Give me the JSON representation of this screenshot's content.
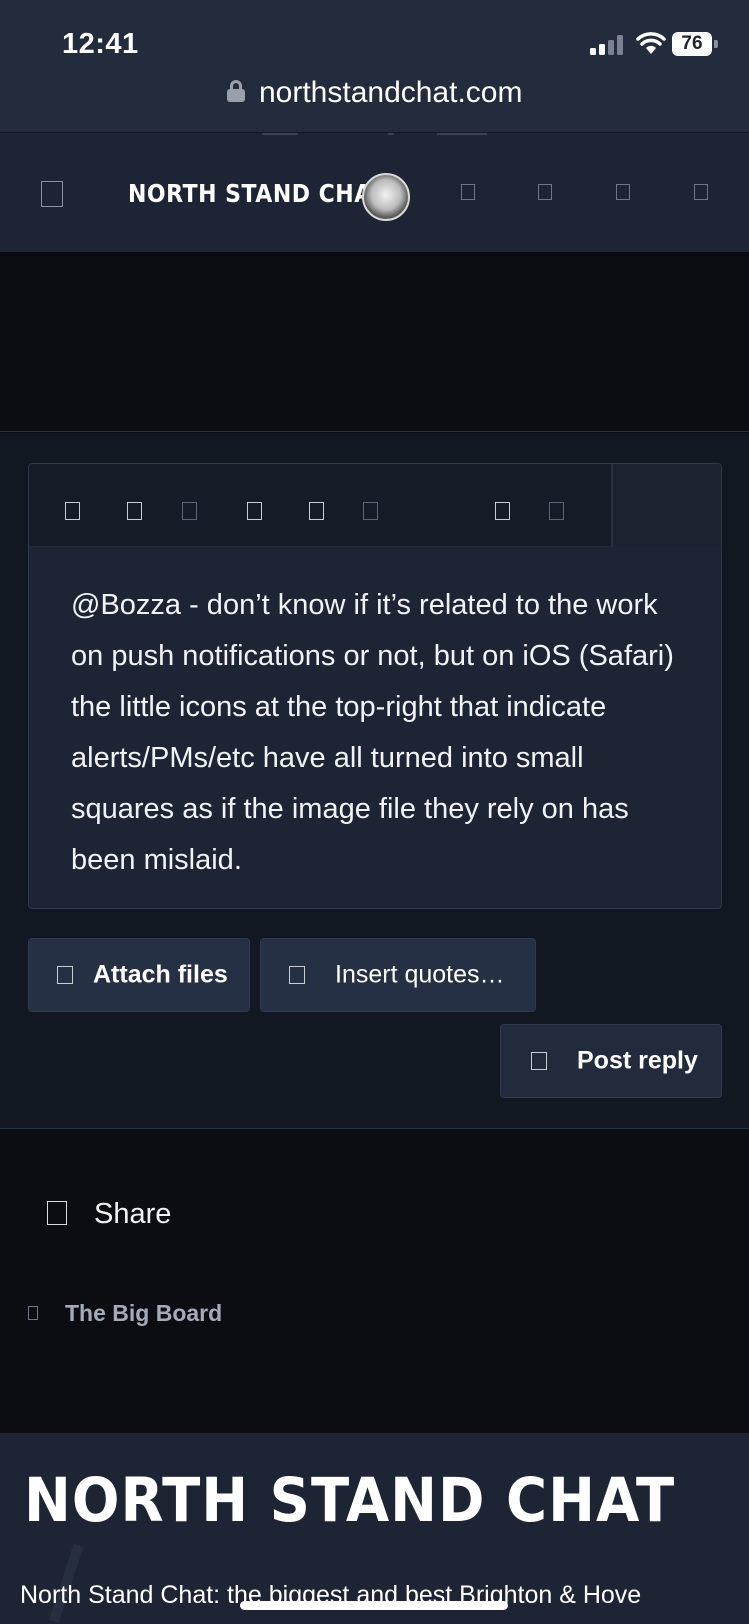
{
  "status_bar": {
    "time": "12:41",
    "battery": "76"
  },
  "browser": {
    "url": "northstandchat.com"
  },
  "site_header": {
    "logo_text": "NORTH STAND CHAT"
  },
  "editor": {
    "text": "@Bozza - don’t know if it’s related to the work on push notifications or not, but on iOS (Safari) the little icons at the top-right that indicate alerts/PMs/etc have all turned into small squares as if the image file they rely on has been mislaid."
  },
  "actions": {
    "attach_label": "Attach files",
    "quotes_label": "Insert quotes…",
    "post_label": "Post reply"
  },
  "share": {
    "label": "Share"
  },
  "breadcrumb": {
    "label": "The Big Board"
  },
  "footer": {
    "logo_text": "NORTH STAND CHAT",
    "description": "North Stand Chat: the biggest and best Brighton & Hove"
  }
}
